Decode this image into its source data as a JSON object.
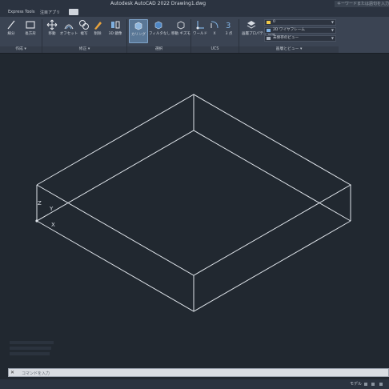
{
  "title_bar": {
    "title": "Autodesk AutoCAD 2022    Drawing1.dwg",
    "search_placeholder": "キーワードまたは語句を入力"
  },
  "ribbon_tabs": [
    {
      "label": "Express Tools"
    },
    {
      "label": "注目アプリ"
    }
  ],
  "ribbon": {
    "buttons": [
      {
        "label": "線分"
      },
      {
        "label": "長方形"
      },
      {
        "label": "移動"
      },
      {
        "label": "オフセット"
      },
      {
        "label": "複写"
      },
      {
        "label": "削除"
      },
      {
        "label": "3D 鏡像"
      },
      {
        "label": "カリング"
      },
      {
        "label": "フィルタなし"
      },
      {
        "label": "移動\nギズモ"
      },
      {
        "label": "ワールド"
      },
      {
        "label": "X"
      },
      {
        "label": "3 点"
      },
      {
        "label": "画層プロパティ\n管理"
      }
    ],
    "groups": [
      {
        "label": "作成 ▾"
      },
      {
        "label": "修正 ▾"
      },
      {
        "label": "選択"
      },
      {
        "label": "UCS"
      },
      {
        "label": "画層とビュー ▾"
      }
    ],
    "combos": [
      {
        "label": "0"
      },
      {
        "label": "2D ワイヤフレーム"
      },
      {
        "label": "未保存のビュー"
      }
    ]
  },
  "ucs": {
    "z_label": "Z",
    "y_label": "Y",
    "x_label": "X"
  },
  "command_line": {
    "placeholder": "コマンドを入力"
  },
  "status_bar": {
    "model_label": "モデル"
  },
  "colors": {
    "canvas": "#212830",
    "wire": "#dfe4ea",
    "ribbon": "#3b4453",
    "selected_button": "#5a7796"
  }
}
